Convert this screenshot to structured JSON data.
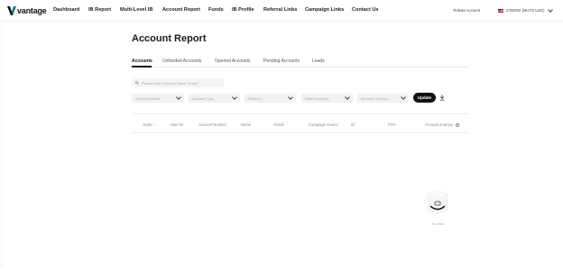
{
  "brand": {
    "name": "vantage"
  },
  "nav": {
    "items": [
      {
        "label": "Dashboard"
      },
      {
        "label": "IB Report"
      },
      {
        "label": "Multi-Level IB"
      },
      {
        "label": "Account Report"
      },
      {
        "label": "Funds"
      },
      {
        "label": "IB Profile"
      },
      {
        "label": "Referral Links"
      },
      {
        "label": "Campaign Links"
      },
      {
        "label": "Contact Us"
      }
    ],
    "rebate_label": "Rebate Account",
    "account_value": "2760002 (MUTO USD)"
  },
  "page": {
    "title": "Account Report"
  },
  "tabs": [
    {
      "label": "Accounts",
      "active": true
    },
    {
      "label": "Unfunded Accounts",
      "active": false
    },
    {
      "label": "Opened Accounts",
      "active": false
    },
    {
      "label": "Pending Accounts",
      "active": false
    },
    {
      "label": "Leads",
      "active": false
    }
  ],
  "search": {
    "placeholder": "Please enter Account Name, Email..."
  },
  "filters": [
    {
      "placeholder": "Sub IB Account"
    },
    {
      "placeholder": "Account Type"
    },
    {
      "placeholder": "Platform"
    },
    {
      "placeholder": "Base Currency"
    },
    {
      "placeholder": "Account Journey"
    }
  ],
  "update_label": "Update",
  "table": {
    "columns": [
      "Order",
      "User ID",
      "Account Number",
      "Name",
      "Email",
      "Campaign source",
      "ID",
      "POA",
      "Account Journey"
    ]
  },
  "empty_text": "No data",
  "colors": {
    "accent": "#111111",
    "brand": "#0a0a0a"
  }
}
